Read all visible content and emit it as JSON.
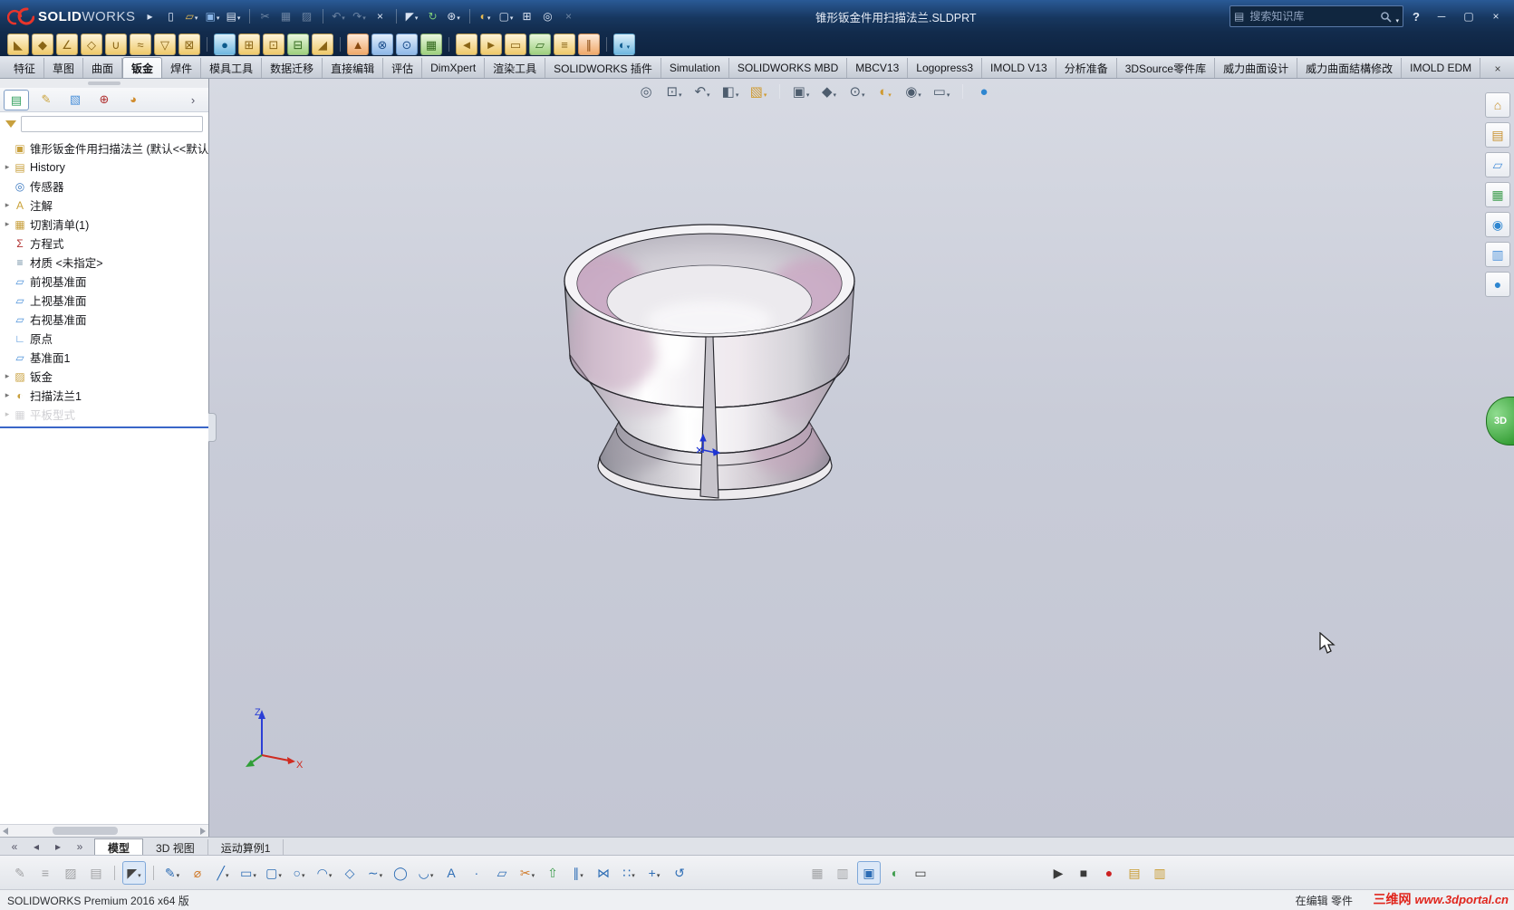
{
  "window": {
    "brand_bold": "SOLID",
    "brand_light": "WORKS",
    "doc_title": "锥形钣金件用扫描法兰.SLDPRT",
    "search_placeholder": "搜索知识库",
    "search_scope_glyph": "▤",
    "help_label": "?"
  },
  "window_controls": [
    {
      "name": "minimize",
      "glyph": "─"
    },
    {
      "name": "maximize",
      "glyph": "▢"
    },
    {
      "name": "close",
      "glyph": "×"
    }
  ],
  "titlebar_icons": [
    {
      "name": "toolbar-expand",
      "glyph": "▸"
    },
    {
      "name": "new-document",
      "glyph": "▯"
    },
    {
      "name": "open",
      "glyph": "▱",
      "cls": "tgold",
      "dd": true
    },
    {
      "name": "save",
      "glyph": "▣",
      "cls": "tblue",
      "dd": true
    },
    {
      "name": "print",
      "glyph": "▤",
      "dd": true
    },
    {
      "sep": true
    },
    {
      "name": "cut",
      "glyph": "✂",
      "dim": true
    },
    {
      "name": "copy",
      "glyph": "▦",
      "dim": true
    },
    {
      "name": "paste",
      "glyph": "▨",
      "dim": true
    },
    {
      "sep": true
    },
    {
      "name": "undo",
      "glyph": "↶",
      "dd": true,
      "dim": true
    },
    {
      "name": "redo",
      "glyph": "↷",
      "dd": true,
      "dim": true
    },
    {
      "name": "close-document",
      "glyph": "×"
    },
    {
      "sep": true
    },
    {
      "name": "select",
      "glyph": "◤",
      "dd": true
    },
    {
      "name": "rebuild",
      "glyph": "↻",
      "cls": "tgreen"
    },
    {
      "name": "options",
      "glyph": "⊛",
      "dd": true
    },
    {
      "sep": true
    },
    {
      "name": "edit-appearance",
      "glyph": "◐",
      "cls": "tgold",
      "dd": true
    },
    {
      "name": "display-settings",
      "glyph": "▢",
      "dd": true
    },
    {
      "name": "window-frame",
      "glyph": "⊞"
    },
    {
      "name": "zoom-magnifier",
      "glyph": "◎"
    },
    {
      "name": "close-toolbar",
      "glyph": "×",
      "dim": true
    }
  ],
  "sheet_metal_toolbar": [
    {
      "name": "base-flange",
      "glyph": "◣",
      "cls": "y"
    },
    {
      "name": "lofted-bend",
      "glyph": "◆",
      "cls": "y"
    },
    {
      "name": "edge-flange",
      "glyph": "∠",
      "cls": "y"
    },
    {
      "name": "miter-flange",
      "glyph": "◇",
      "cls": "y"
    },
    {
      "name": "hem",
      "glyph": "∪",
      "cls": "y"
    },
    {
      "name": "jog",
      "glyph": "≈",
      "cls": "y"
    },
    {
      "name": "sketched-bend",
      "glyph": "▽",
      "cls": "y"
    },
    {
      "name": "cross-break",
      "glyph": "⊠",
      "cls": "y"
    },
    {
      "sep": true
    },
    {
      "name": "globe-tool",
      "glyph": "●",
      "cls": "c2"
    },
    {
      "name": "closed-corner",
      "glyph": "⊞",
      "cls": "y"
    },
    {
      "name": "welded-corner",
      "glyph": "⊡",
      "cls": "y"
    },
    {
      "name": "corner-relief",
      "glyph": "⊟",
      "cls": "g2"
    },
    {
      "name": "break-corner",
      "glyph": "◢",
      "cls": "y"
    },
    {
      "sep": true
    },
    {
      "name": "forming-tool",
      "glyph": "▲",
      "cls": "o2"
    },
    {
      "name": "extruded-cut",
      "glyph": "⊗",
      "cls": "b2"
    },
    {
      "name": "simple-hole",
      "glyph": "⊙",
      "cls": "b2"
    },
    {
      "name": "vent",
      "glyph": "▦",
      "cls": "g2"
    },
    {
      "sep": true
    },
    {
      "name": "unfold",
      "glyph": "◄",
      "cls": "y"
    },
    {
      "name": "fold",
      "glyph": "►",
      "cls": "y"
    },
    {
      "name": "flatten",
      "glyph": "▭",
      "cls": "y"
    },
    {
      "name": "no-bends",
      "glyph": "▱",
      "cls": "g2"
    },
    {
      "name": "insert-bends",
      "glyph": "≡",
      "cls": "y"
    },
    {
      "name": "rip",
      "glyph": "∥",
      "cls": "o2"
    },
    {
      "sep": true
    },
    {
      "name": "swept-flange",
      "glyph": "◐",
      "cls": "c2",
      "dd": true
    }
  ],
  "tabrow_icons": [
    {
      "name": "close-command-manager",
      "glyph": "×"
    }
  ],
  "ribbon_tabs": [
    {
      "label": "特征"
    },
    {
      "label": "草图"
    },
    {
      "label": "曲面"
    },
    {
      "label": "钣金",
      "active": true
    },
    {
      "label": "焊件"
    },
    {
      "label": "模具工具"
    },
    {
      "label": "数据迁移"
    },
    {
      "label": "直接编辑"
    },
    {
      "label": "评估"
    },
    {
      "label": "DimXpert"
    },
    {
      "label": "渲染工具"
    },
    {
      "label": "SOLIDWORKS 插件"
    },
    {
      "label": "Simulation"
    },
    {
      "label": "SOLIDWORKS MBD"
    },
    {
      "label": "MBCV13"
    },
    {
      "label": "Logopress3"
    },
    {
      "label": "IMOLD V13"
    },
    {
      "label": "分析准备"
    },
    {
      "label": "3DSource零件库"
    },
    {
      "label": "威力曲面设计"
    },
    {
      "label": "威力曲面結構修改"
    },
    {
      "label": "IMOLD EDM"
    }
  ],
  "manager_tabs": [
    {
      "name": "featuremanager",
      "glyph": "▤",
      "color": "#2e9e5b",
      "pressed": true
    },
    {
      "name": "propertymanager",
      "glyph": "✎",
      "color": "#caa23a"
    },
    {
      "name": "configurationmanager",
      "glyph": "▧",
      "color": "#4a90d9"
    },
    {
      "name": "dimxpertmanager",
      "glyph": "⊕",
      "color": "#b03030"
    },
    {
      "name": "displaymanager",
      "glyph": "◕",
      "color": "#d08b2c"
    }
  ],
  "manager_expand": [
    {
      "name": "expand-panel",
      "glyph": "›"
    }
  ],
  "feature_tree": [
    {
      "icon": "▣",
      "icon_name": "part",
      "color": "#c8a03e",
      "label": "锥形钣金件用扫描法兰 (默认<<默认>_"
    },
    {
      "arrow": true,
      "icon": "▤",
      "icon_name": "history-folder",
      "color": "#c8a03e",
      "label": "History"
    },
    {
      "icon": "◎",
      "icon_name": "sensors",
      "color": "#3a78c0",
      "label": "传感器"
    },
    {
      "arrow": true,
      "icon": "A",
      "icon_name": "annotations",
      "color": "#caa23a",
      "label": "注解"
    },
    {
      "arrow": true,
      "icon": "▦",
      "icon_name": "cut-list",
      "color": "#c8a03e",
      "label": "切割清单(1)"
    },
    {
      "icon": "Σ",
      "icon_name": "equations",
      "color": "#b03030",
      "label": "方程式"
    },
    {
      "icon": "≡",
      "icon_name": "material",
      "color": "#6a8aa0",
      "label": "材质 <未指定>"
    },
    {
      "icon": "▱",
      "icon_name": "front-plane",
      "color": "#4a90d9",
      "label": "前视基准面"
    },
    {
      "icon": "▱",
      "icon_name": "top-plane",
      "color": "#4a90d9",
      "label": "上视基准面"
    },
    {
      "icon": "▱",
      "icon_name": "right-plane",
      "color": "#4a90d9",
      "label": "右视基准面"
    },
    {
      "icon": "∟",
      "icon_name": "origin",
      "color": "#4a90d9",
      "label": "原点"
    },
    {
      "icon": "▱",
      "icon_name": "plane1",
      "color": "#4a90d9",
      "label": "基准面1"
    },
    {
      "arrow": true,
      "icon": "▨",
      "icon_name": "sheet-metal-folder",
      "color": "#c8a03e",
      "label": "钣金"
    },
    {
      "arrow": true,
      "icon": "◐",
      "icon_name": "swept-flange-feature",
      "color": "#c8a03e",
      "label": "扫描法兰1"
    },
    {
      "arrow": true,
      "icon": "▦",
      "icon_name": "flat-pattern",
      "color": "#9a9aa2",
      "label": "平板型式",
      "dim": true
    }
  ],
  "hud_icons": [
    {
      "name": "zoom-to-fit",
      "glyph": "◎"
    },
    {
      "name": "zoom-to-area",
      "glyph": "⊡",
      "dd": true
    },
    {
      "name": "previous-view",
      "glyph": "↶",
      "dd": true
    },
    {
      "name": "section-view",
      "glyph": "◧",
      "dd": true
    },
    {
      "name": "3d-drawing-view",
      "glyph": "▧",
      "cls": "tgold",
      "dd": true
    },
    {
      "sep": true
    },
    {
      "name": "view-orientation",
      "glyph": "▣",
      "dd": true
    },
    {
      "name": "display-style",
      "glyph": "◆",
      "dd": true
    },
    {
      "name": "hide-show-items",
      "glyph": "⊙",
      "dd": true
    },
    {
      "name": "edit-appearance-hud",
      "glyph": "◐",
      "cls": "tgold",
      "dd": true
    },
    {
      "name": "apply-scene",
      "glyph": "◉",
      "dd": true
    },
    {
      "name": "view-settings",
      "glyph": "▭",
      "dd": true
    },
    {
      "sep": true
    },
    {
      "name": "realview-sphere",
      "glyph": "●",
      "cls": "cblue"
    }
  ],
  "taskpane_icons": [
    {
      "name": "home",
      "glyph": "⌂",
      "color": "#c8912e"
    },
    {
      "name": "design-library",
      "glyph": "▤",
      "color": "#c8912e"
    },
    {
      "name": "file-explorer",
      "glyph": "▱",
      "color": "#4a90d9"
    },
    {
      "name": "view-palette",
      "glyph": "▦",
      "color": "#3f9d4e"
    },
    {
      "name": "appearances",
      "glyph": "◉",
      "color": "#2e86d0"
    },
    {
      "name": "custom-properties",
      "glyph": "▥",
      "color": "#4a90d9"
    },
    {
      "name": "solidworks-forum",
      "glyph": "●",
      "color": "#2e86d0"
    }
  ],
  "viewport": {
    "resource_tab_label": "3D"
  },
  "triad": {
    "x_label": "X",
    "z_label": "Z"
  },
  "doctab_nav": [
    {
      "name": "scroll-first",
      "glyph": "«"
    },
    {
      "name": "scroll-prev",
      "glyph": "◂"
    },
    {
      "name": "scroll-next",
      "glyph": "▸"
    },
    {
      "name": "scroll-last",
      "glyph": "»"
    }
  ],
  "doc_tabs": [
    {
      "label": "模型",
      "active": true
    },
    {
      "label": "3D 视图"
    },
    {
      "label": "运动算例1"
    }
  ],
  "bottom_toolbar": [
    {
      "name": "ink-pen",
      "glyph": "✎",
      "cls": "c-k",
      "dim": true
    },
    {
      "name": "ink-highlight",
      "glyph": "≡",
      "cls": "c-k",
      "dim": true
    },
    {
      "name": "ink-erase",
      "glyph": "▨",
      "cls": "c-k",
      "dim": true
    },
    {
      "name": "notes",
      "glyph": "▤",
      "cls": "c-k",
      "dim": true
    },
    {
      "sep": true
    },
    {
      "name": "select-bottom",
      "glyph": "◤",
      "pressed": true,
      "dd": true
    },
    {
      "sep": true
    },
    {
      "name": "sketch",
      "glyph": "✎",
      "cls": "c-b",
      "dd": true
    },
    {
      "name": "smart-dimension",
      "glyph": "⌀",
      "cls": "c-o"
    },
    {
      "name": "line",
      "glyph": "╱",
      "cls": "c-b",
      "dd": true
    },
    {
      "name": "corner-rectangle",
      "glyph": "▭",
      "cls": "c-b",
      "dd": true
    },
    {
      "name": "straight-slot",
      "glyph": "▢",
      "cls": "c-b",
      "dd": true
    },
    {
      "name": "circle",
      "glyph": "○",
      "cls": "c-b",
      "dd": true
    },
    {
      "name": "centerpoint-arc",
      "glyph": "◠",
      "cls": "c-b",
      "dd": true
    },
    {
      "name": "polygon",
      "glyph": "◇",
      "cls": "c-b"
    },
    {
      "name": "spline",
      "glyph": "∼",
      "cls": "c-b",
      "dd": true
    },
    {
      "name": "ellipse",
      "glyph": "◯",
      "cls": "c-b"
    },
    {
      "name": "sketch-fillet",
      "glyph": "◡",
      "cls": "c-b",
      "dd": true
    },
    {
      "name": "text",
      "glyph": "A",
      "cls": "c-b"
    },
    {
      "name": "point",
      "glyph": "∙",
      "cls": "c-b"
    },
    {
      "name": "plane",
      "glyph": "▱",
      "cls": "c-b"
    },
    {
      "name": "trim-entities",
      "glyph": "✂",
      "cls": "c-o",
      "dd": true
    },
    {
      "name": "convert-entities",
      "glyph": "⇧",
      "cls": "c-g"
    },
    {
      "name": "offset-entities",
      "glyph": "∥",
      "cls": "c-b",
      "dd": true
    },
    {
      "name": "mirror-entities",
      "glyph": "⋈",
      "cls": "c-b"
    },
    {
      "name": "linear-sketch-pattern",
      "glyph": "∷",
      "cls": "c-b",
      "dd": true
    },
    {
      "name": "move-entities",
      "glyph": "+",
      "cls": "c-b",
      "dd": true
    },
    {
      "name": "rotate-entities",
      "glyph": "↺",
      "cls": "c-b"
    },
    {
      "gap": true
    },
    {
      "name": "display-grid",
      "glyph": "▦",
      "cls": "c-k",
      "dim": true
    },
    {
      "name": "units",
      "glyph": "▥",
      "cls": "c-k",
      "dim": true
    },
    {
      "name": "instant2d",
      "glyph": "▣",
      "cls": "c-b",
      "pressed": true
    },
    {
      "name": "shaded-sketch-contours",
      "glyph": "◐",
      "cls": "c-g"
    },
    {
      "name": "no-preview",
      "glyph": "▭",
      "cls": "c-k"
    },
    {
      "gap": true
    },
    {
      "name": "play",
      "glyph": "▶",
      "cls": "c-k"
    },
    {
      "name": "stop",
      "glyph": "■",
      "cls": "c-k"
    },
    {
      "name": "record",
      "glyph": "●",
      "cls": "c-r"
    },
    {
      "name": "animation-snapshot",
      "glyph": "▤",
      "cls": "c-y"
    },
    {
      "name": "publish-emodel",
      "glyph": "▥",
      "cls": "c-y"
    }
  ],
  "statusbar": {
    "left": "SOLIDWORKS Premium 2016 x64 版",
    "editing": "在编辑 零件",
    "watermark_name": "三维网",
    "watermark_url": "www.3dportal.cn"
  }
}
